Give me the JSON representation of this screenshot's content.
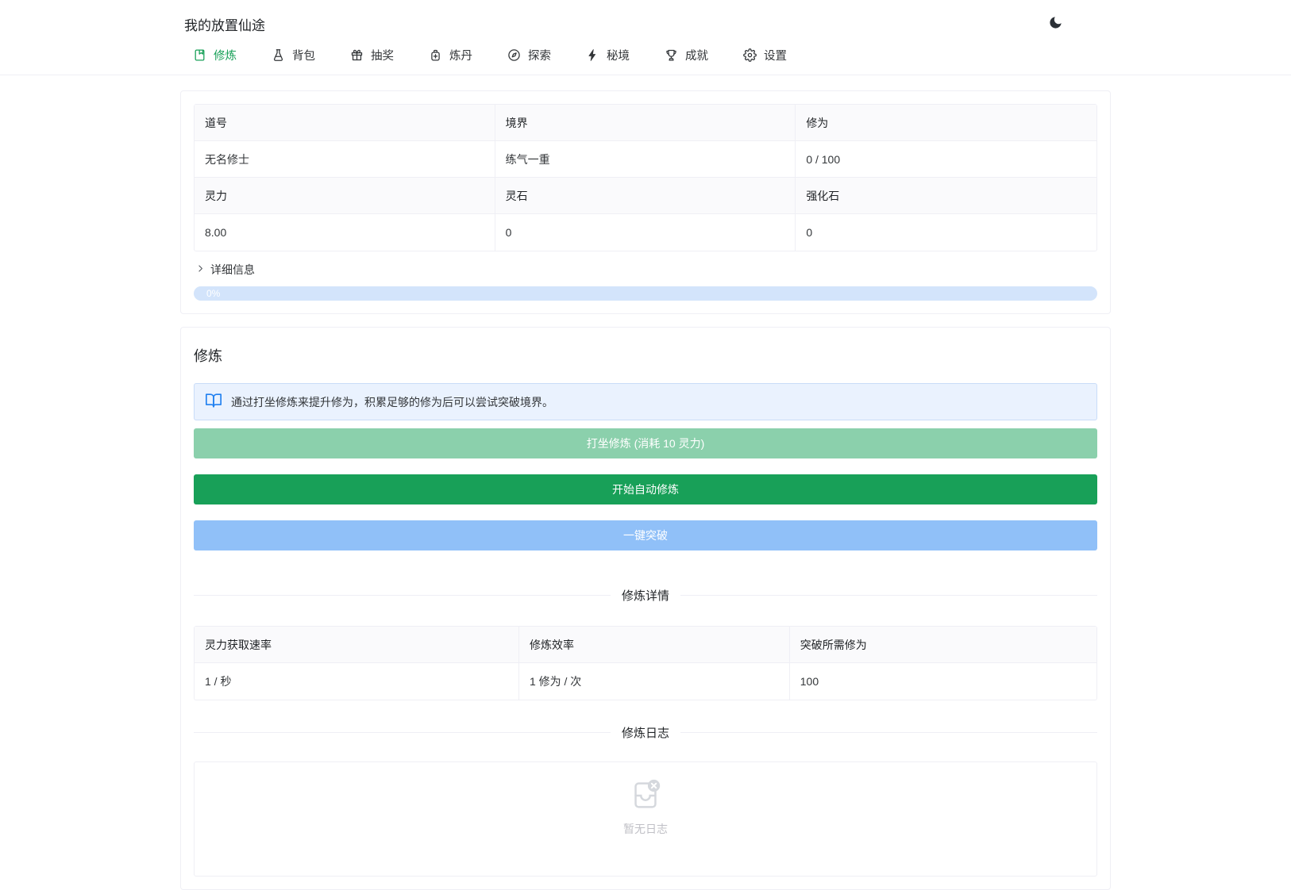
{
  "app": {
    "title": "我的放置仙途",
    "theme_toggle_icon": "moon-icon"
  },
  "nav": {
    "tabs": [
      {
        "label": "修炼",
        "icon": "book-icon",
        "active": true
      },
      {
        "label": "背包",
        "icon": "flask-icon",
        "active": false
      },
      {
        "label": "抽奖",
        "icon": "gift-icon",
        "active": false
      },
      {
        "label": "炼丹",
        "icon": "potion-icon",
        "active": false
      },
      {
        "label": "探索",
        "icon": "compass-icon",
        "active": false
      },
      {
        "label": "秘境",
        "icon": "bolt-icon",
        "active": false
      },
      {
        "label": "成就",
        "icon": "trophy-icon",
        "active": false
      },
      {
        "label": "设置",
        "icon": "gear-icon",
        "active": false
      }
    ]
  },
  "stats": {
    "rows": [
      {
        "header": true,
        "cells": [
          "道号",
          "境界",
          "修为"
        ]
      },
      {
        "header": false,
        "cells": [
          "无名修士",
          "练气一重",
          "0 / 100"
        ]
      },
      {
        "header": true,
        "cells": [
          "灵力",
          "灵石",
          "强化石"
        ]
      },
      {
        "header": false,
        "cells": [
          "8.00",
          "0",
          "0"
        ]
      }
    ],
    "details_toggle": "详细信息",
    "progress": {
      "label": "0%",
      "percent": 0
    }
  },
  "cultivation": {
    "title": "修炼",
    "tip": "通过打坐修炼来提升修为，积累足够的修为后可以尝试突破境界。",
    "buttons": {
      "meditate": "打坐修炼 (消耗 10 灵力)",
      "auto": "开始自动修炼",
      "breakthrough": "一键突破"
    },
    "details": {
      "divider": "修炼详情",
      "headers": [
        "灵力获取速率",
        "修炼效率",
        "突破所需修为"
      ],
      "values": [
        "1 / 秒",
        "1 修为 / 次",
        "100"
      ]
    },
    "log": {
      "divider": "修炼日志",
      "empty_text": "暂无日志",
      "empty_icon": "inbox-x-icon"
    }
  },
  "colors": {
    "success": "#18a058",
    "success_disabled": "#8bd0ac",
    "primary": "#2080f0",
    "primary_disabled": "#90c0f8",
    "progress_track": "#d3e4fb",
    "alert_bg": "#eaf2fe",
    "border": "#efeff5",
    "table_header_bg": "#fafafc",
    "muted_text": "#c0c0c6"
  }
}
